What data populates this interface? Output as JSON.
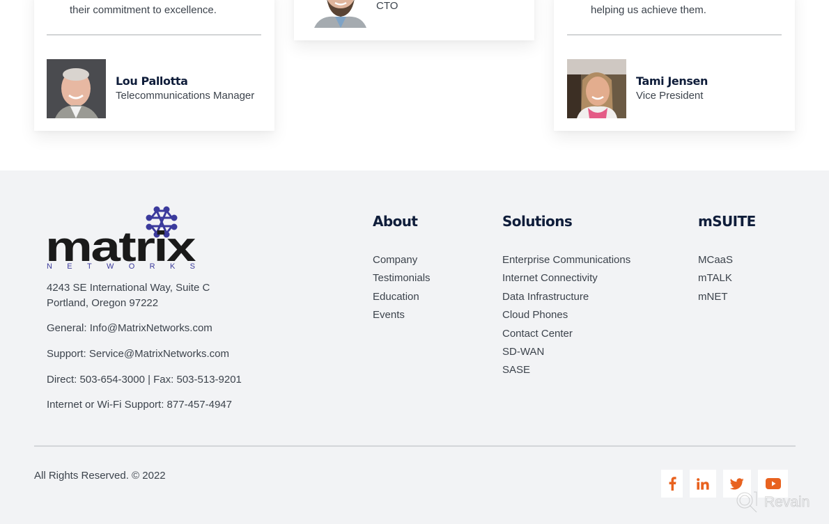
{
  "testimonials": {
    "left": {
      "quote_tail": "their commitment to excellence.",
      "name": "Lou Pallotta",
      "title": "Telecommunications Manager"
    },
    "middle": {
      "title": "CTO"
    },
    "right": {
      "quote_tail": "helping us achieve them.",
      "name": "Tami Jensen",
      "title": "Vice President"
    }
  },
  "footer": {
    "logo": {
      "wordmark": "matrix",
      "subtitle": "NETWORKS",
      "accent_color": "#3b3a9c"
    },
    "contact": {
      "address_line1": "4243 SE International Way, Suite C",
      "address_line2": "Portland, Oregon 97222",
      "general": "General: Info@MatrixNetworks.com",
      "support": "Support: Service@MatrixNetworks.com",
      "direct_fax": "Direct: 503-654-3000 | Fax: 503-513-9201",
      "internet_support": "Internet or Wi-Fi Support: 877-457-4947"
    },
    "columns": [
      {
        "heading": "About",
        "links": [
          "Company",
          "Testimonials",
          "Education",
          "Events"
        ]
      },
      {
        "heading": "Solutions",
        "links": [
          "Enterprise Communications",
          "Internet Connectivity",
          "Data Infrastructure",
          "Cloud Phones",
          "Contact Center",
          "SD-WAN",
          "SASE"
        ]
      },
      {
        "heading": "mSUITE",
        "links": [
          "MCaaS",
          "mTALK",
          "mNET"
        ]
      }
    ],
    "copyright": "All Rights Reserved. © 2022",
    "social": [
      {
        "icon": "facebook-icon"
      },
      {
        "icon": "linkedin-icon"
      },
      {
        "icon": "twitter-icon"
      },
      {
        "icon": "youtube-icon"
      }
    ],
    "social_color": "#e8621f"
  },
  "watermark": {
    "text": "Revain"
  }
}
